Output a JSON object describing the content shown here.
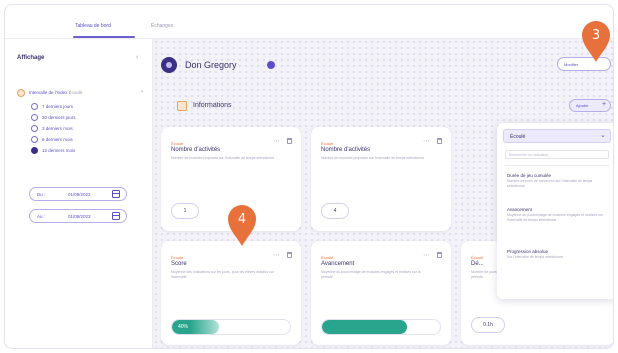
{
  "tabs": [
    {
      "label": "Tableau de bord",
      "active": true
    },
    {
      "label": "Échanges",
      "active": false
    }
  ],
  "sidebar": {
    "title": "Affichage",
    "interval": {
      "label": "Intervalle de l'index",
      "sub": "Écoulé"
    },
    "radios": [
      {
        "label": "7 derniers jours",
        "selected": false
      },
      {
        "label": "30 derniers jours",
        "selected": false
      },
      {
        "label": "3 derniers mois",
        "selected": false
      },
      {
        "label": "6 derniers mois",
        "selected": false
      },
      {
        "label": "12 derniers mois",
        "selected": true
      }
    ],
    "date_from": {
      "prefix": "Du :",
      "value": "01/09/2022"
    },
    "date_to": {
      "prefix": "Au :",
      "value": "01/09/2023"
    }
  },
  "header": {
    "user_name": "Don Gregory",
    "pill_label": "Modifier"
  },
  "section": {
    "title": "Informations",
    "add_label": "Ajouter"
  },
  "cards": [
    {
      "tag": "Écoulé",
      "title": "Nombre d'activités",
      "desc": "Nombre de modules proposés sur l'intervalle de temps sélectionné",
      "value": "1"
    },
    {
      "tag": "Écoulé",
      "title": "Nombre d'activités",
      "desc": "Nombre de modules proposés sur l'intervalle de temps sélectionné",
      "value": "4"
    },
    {
      "tag": "Écoulé",
      "title": "Score",
      "desc": "Moyenne des indicateurs sur les jours, pour les élèves assidus sur l'intervalle",
      "value": "40%",
      "progress": 0.4
    },
    {
      "tag": "Écoulé",
      "title": "Avancement",
      "desc": "Moyenne du pourcentage de modules engagés et réalisés sur la période",
      "value": "",
      "progress": 0.72
    },
    {
      "tag": "Écoulé",
      "title": "Dé...",
      "desc": "Nombre de jours entre la première connexion et la dernière sur la période",
      "value": "0.1h"
    }
  ],
  "dropdown": {
    "selected": "Écoulé",
    "search_placeholder": "Rechercher un indicateur",
    "options": [
      {
        "title": "Durée de jeu cumulée",
        "desc": "Nombre de jours de connexion sur l'intervalle de temps sélectionné"
      },
      {
        "title": "Avancement",
        "desc": "Moyenne du pourcentage de modules engagés et réalisés sur l'intervalle de temps sélectionné"
      },
      {
        "title": "Progression absolue",
        "desc": "Sur l'intervalle de temps sélectionné"
      }
    ]
  },
  "step_markers": [
    {
      "label": "3"
    },
    {
      "label": "4"
    }
  ],
  "colors": {
    "accent": "#5b4fc7",
    "orange": "#e8703a",
    "teal": "#2aa58d"
  }
}
